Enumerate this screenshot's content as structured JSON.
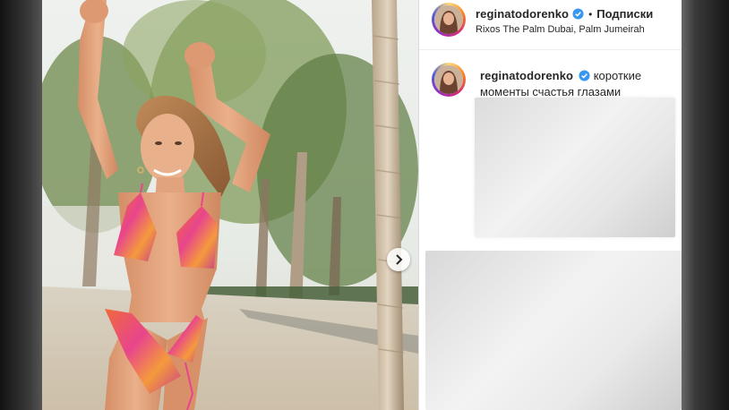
{
  "post": {
    "username": "reginatodorenko",
    "follow_label": "Подписки",
    "location": "Rixos The Palm Dubai, Palm Jumeirah",
    "caption_text": "короткие моменты счастья глазами"
  },
  "icons": {
    "next": "chevron-right-icon",
    "verified": "verified-badge-icon"
  },
  "colors": {
    "verified_blue": "#3897f0",
    "text": "#262626",
    "story_ring": [
      "#feda75",
      "#fa7e1e",
      "#d62976",
      "#962fbf",
      "#4f5bd5"
    ]
  }
}
